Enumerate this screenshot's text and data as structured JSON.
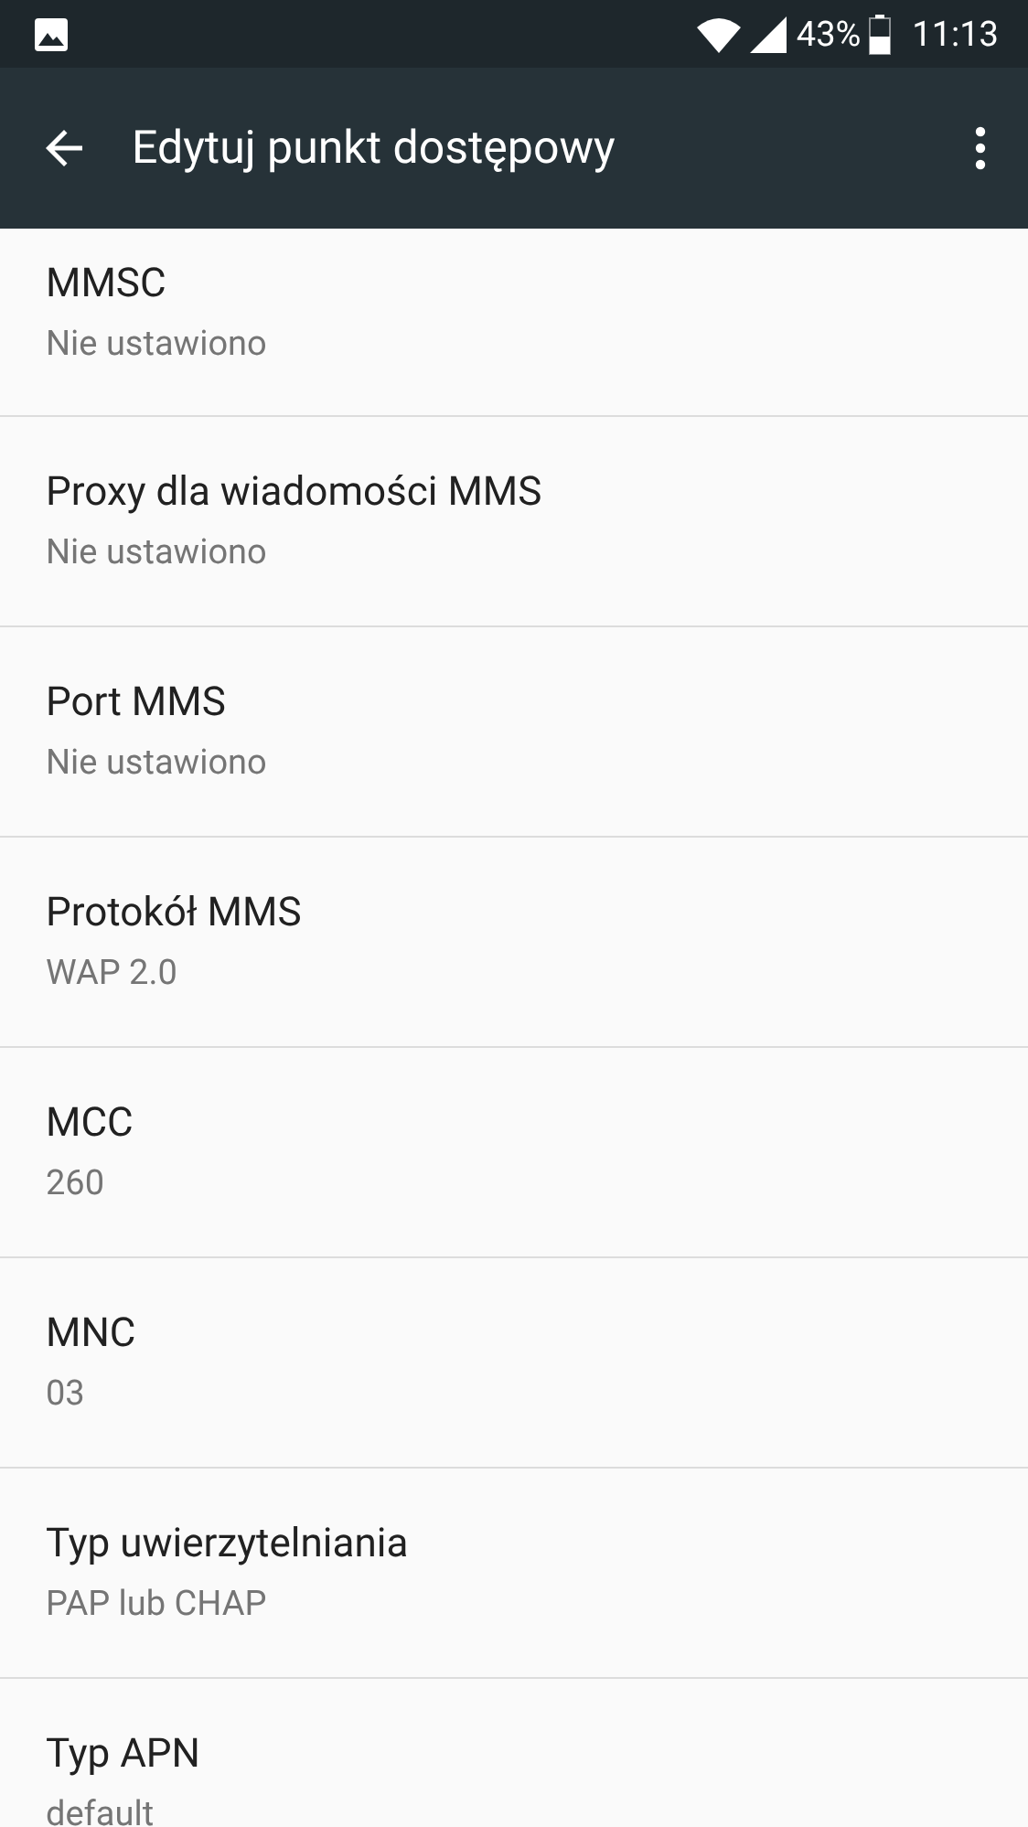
{
  "status_bar": {
    "battery": "43%",
    "time": "11:13"
  },
  "toolbar": {
    "title": "Edytuj punkt dostępowy"
  },
  "settings": [
    {
      "title": "MMSC",
      "value": "Nie ustawiono"
    },
    {
      "title": "Proxy dla wiadomości MMS",
      "value": "Nie ustawiono"
    },
    {
      "title": "Port MMS",
      "value": "Nie ustawiono"
    },
    {
      "title": "Protokół MMS",
      "value": "WAP 2.0"
    },
    {
      "title": "MCC",
      "value": "260"
    },
    {
      "title": "MNC",
      "value": "03"
    },
    {
      "title": "Typ uwierzytelniania",
      "value": "PAP lub CHAP"
    },
    {
      "title": "Typ APN",
      "value": "default"
    }
  ]
}
